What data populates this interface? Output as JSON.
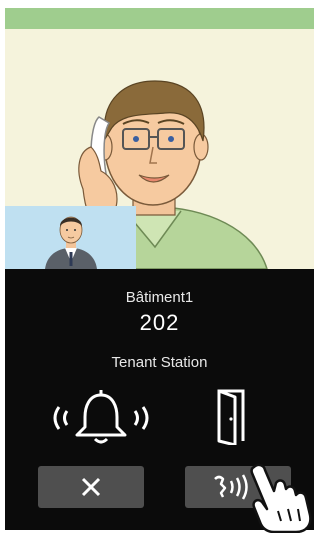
{
  "call": {
    "building": "Bâtiment1",
    "room": "202",
    "station": "Tenant Station"
  },
  "icons": {
    "ringing": "ringing-bell-icon",
    "door": "door-icon",
    "hangup": "close-icon",
    "talk": "talk-icon",
    "hand": "pointing-hand-icon"
  },
  "colors": {
    "status_bar": "#9fcd8e",
    "panel": "#0b0b0b",
    "button": "#4f4f4f"
  }
}
